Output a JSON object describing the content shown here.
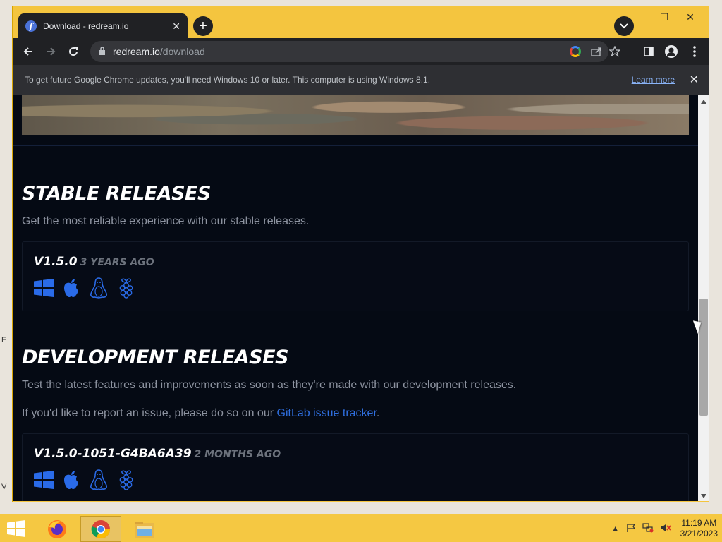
{
  "desktop": {
    "side_letters": [
      "E",
      "V"
    ]
  },
  "window": {
    "tab_title": "Download - redream.io",
    "tab_close": "✕",
    "new_tab": "+",
    "controls": {
      "minimize": "—",
      "maximize": "☐",
      "close": "✕"
    }
  },
  "toolbar": {
    "url_host": "redream.io",
    "url_path": "/download"
  },
  "infobar": {
    "message": "To get future Google Chrome updates, you'll need Windows 10 or later. This computer is using Windows 8.1.",
    "link": "Learn more",
    "close": "✕"
  },
  "page": {
    "stable": {
      "title": "STABLE RELEASES",
      "description": "Get the most reliable experience with our stable releases.",
      "release": {
        "version": "V1.5.0",
        "age": "3 YEARS AGO"
      }
    },
    "development": {
      "title": "DEVELOPMENT RELEASES",
      "description": "Test the latest features and improvements as soon as they're made with our development releases.",
      "issue_prefix": "If you'd like to report an issue, please do so on our ",
      "issue_link": "GitLab issue tracker",
      "issue_suffix": ".",
      "release": {
        "version": "V1.5.0-1051-G4BA6A39",
        "age": "2 MONTHS AGO"
      }
    },
    "platform_icons": [
      "windows-icon",
      "apple-icon",
      "linux-icon",
      "raspberry-pi-icon"
    ],
    "accent_color": "#2f6fe0"
  },
  "taskbar": {
    "time": "11:19 AM",
    "date": "3/21/2023"
  }
}
